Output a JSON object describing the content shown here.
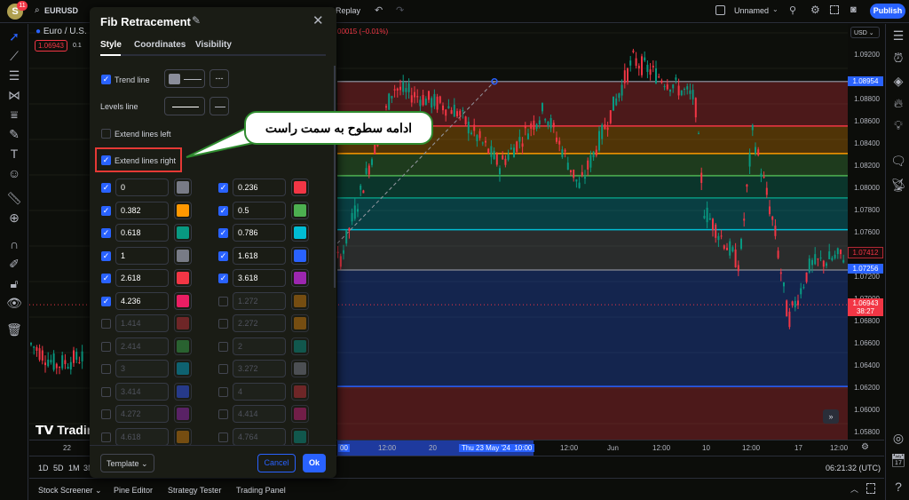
{
  "topbar": {
    "avatar": "S",
    "notifications": "11",
    "symbol": "EURUSD",
    "replay": "Replay",
    "layout_name": "Unnamed",
    "publish": "Publish"
  },
  "legend": {
    "symbol": "Euro / U.S.",
    "price": "1.06943",
    "spread": "0.1",
    "change": "00015 (−0.01%)"
  },
  "dialog": {
    "title": "Fib Retracement",
    "tabs": [
      "Style",
      "Coordinates",
      "Visibility"
    ],
    "trend_line": "Trend line",
    "levels_line": "Levels line",
    "extend_left": "Extend lines left",
    "extend_right": "Extend lines right",
    "template": "Template",
    "cancel": "Cancel",
    "ok": "Ok",
    "levels": [
      {
        "value": "0",
        "color": "#787b86",
        "on": true
      },
      {
        "value": "0.236",
        "color": "#f23645",
        "on": true
      },
      {
        "value": "0.382",
        "color": "#ff9800",
        "on": true
      },
      {
        "value": "0.5",
        "color": "#4caf50",
        "on": true
      },
      {
        "value": "0.618",
        "color": "#089981",
        "on": true
      },
      {
        "value": "0.786",
        "color": "#00bcd4",
        "on": true
      },
      {
        "value": "1",
        "color": "#787b86",
        "on": true
      },
      {
        "value": "1.618",
        "color": "#2962ff",
        "on": true
      },
      {
        "value": "2.618",
        "color": "#f23645",
        "on": true
      },
      {
        "value": "3.618",
        "color": "#9c27b0",
        "on": true
      },
      {
        "value": "4.236",
        "color": "#e91e63",
        "on": true
      },
      {
        "value": "1.272",
        "color": "#945e10",
        "on": false
      },
      {
        "value": "1.414",
        "color": "#8b2a2e",
        "on": false
      },
      {
        "value": "2.272",
        "color": "#945e10",
        "on": false
      },
      {
        "value": "2.414",
        "color": "#2f7a3a",
        "on": false
      },
      {
        "value": "2",
        "color": "#0e6b60",
        "on": false
      },
      {
        "value": "3",
        "color": "#0a7a90",
        "on": false
      },
      {
        "value": "3.272",
        "color": "#5d6068",
        "on": false
      },
      {
        "value": "3.414",
        "color": "#2a45b0",
        "on": false
      },
      {
        "value": "4",
        "color": "#8b2a2e",
        "on": false
      },
      {
        "value": "4.272",
        "color": "#6e2480",
        "on": false
      },
      {
        "value": "4.414",
        "color": "#8e1f5a",
        "on": false
      },
      {
        "value": "4.618",
        "color": "#945e10",
        "on": false
      },
      {
        "value": "4.764",
        "color": "#0e6b60",
        "on": false
      }
    ]
  },
  "callout": "ادامه سطوح به سمت راست",
  "price_axis": {
    "currency": "USD",
    "labels": [
      "1.09200",
      "1.08800",
      "1.08600",
      "1.08400",
      "1.08200",
      "1.08000",
      "1.07800",
      "1.07600",
      "1.07200",
      "1.07000",
      "1.06800",
      "1.06600",
      "1.06400",
      "1.06200",
      "1.06000",
      "1.05800"
    ],
    "fib_high": "1.08954",
    "fib_low": "1.07256",
    "crosshair": "1.07412",
    "last": "1.06943",
    "countdown": "38:27"
  },
  "time_axis": {
    "labels": [
      "22",
      "12:00",
      "20",
      "12:00",
      "Jun",
      "12:00",
      "10",
      "12:00",
      "17",
      "12:00"
    ],
    "range_start": "00",
    "range_label": "Thu 23 May '24",
    "range_time": "10:00"
  },
  "ranges": [
    "1D",
    "5D",
    "1M",
    "3M"
  ],
  "clock": "06:21:32 (UTC)",
  "bottom_tabs": [
    "Stock Screener",
    "Pine Editor",
    "Strategy Tester",
    "Trading Panel"
  ],
  "logo": "Tradin"
}
